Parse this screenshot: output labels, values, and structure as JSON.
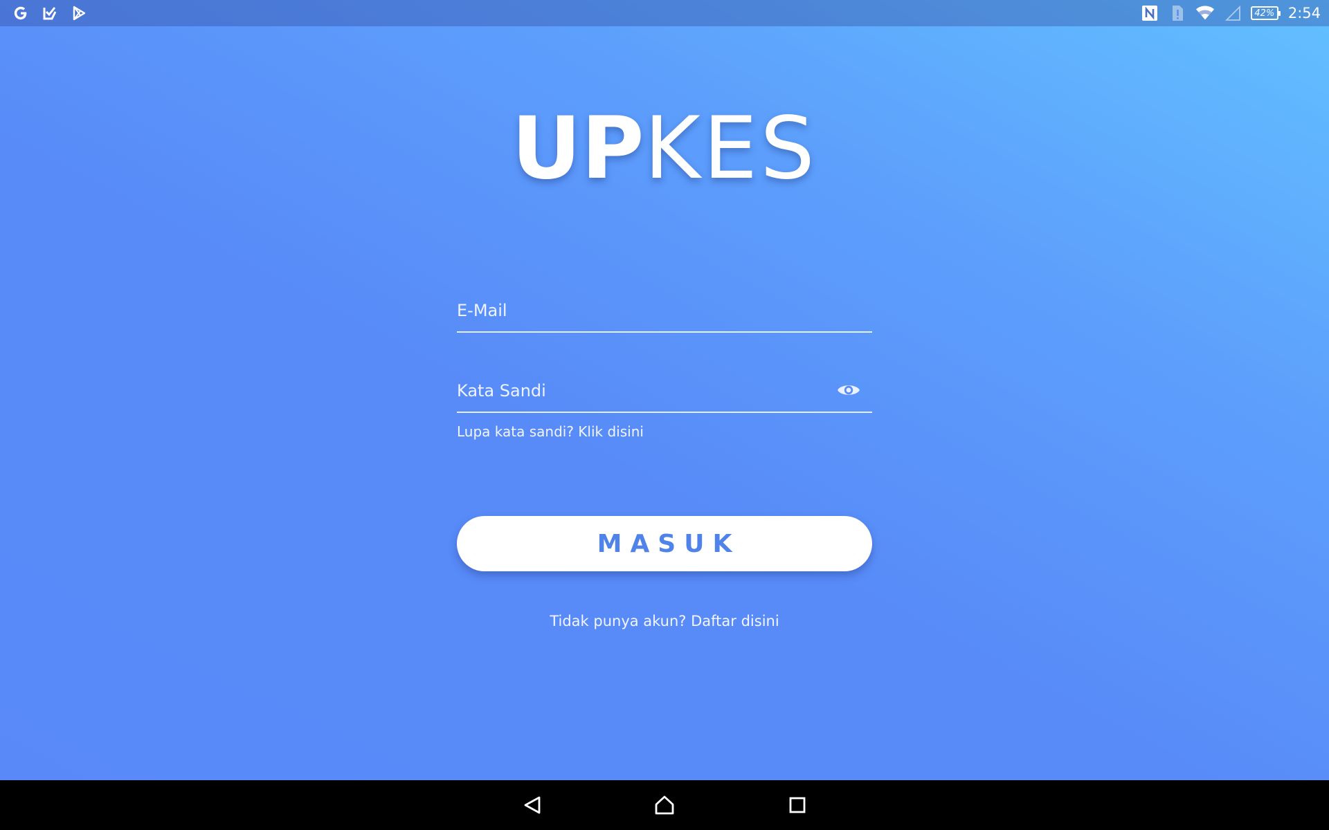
{
  "status_bar": {
    "left_icons": [
      "google-icon",
      "tasks-icon",
      "play-store-icon"
    ],
    "right_icons": [
      "nfc-icon",
      "sim-alert-icon",
      "wifi-icon",
      "cell-signal-icon"
    ],
    "battery": "42%",
    "time": "2:54"
  },
  "logo": {
    "bold_part": "UP",
    "light_part": "KES"
  },
  "form": {
    "email_placeholder": "E-Mail",
    "password_placeholder": "Kata Sandi",
    "forgot_password": "Lupa kata sandi? Klik disini",
    "login_button": "MASUK",
    "register_prompt": "Tidak punya akun? Daftar disini"
  },
  "nav_bar": {
    "buttons": [
      "back-icon",
      "home-icon",
      "recents-icon"
    ]
  },
  "colors": {
    "gradient_top_right": "#62c0ff",
    "gradient_main": "#588bf8",
    "button_text": "#4f83ea",
    "nav_bar": "#000000"
  }
}
